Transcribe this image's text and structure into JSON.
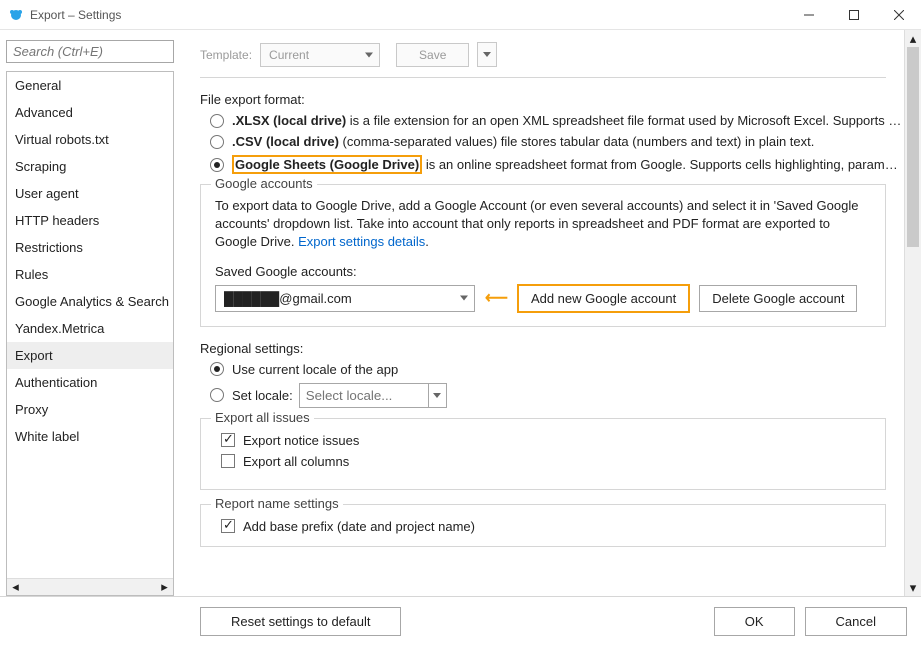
{
  "window": {
    "title": "Export – Settings"
  },
  "search": {
    "placeholder": "Search (Ctrl+E)"
  },
  "sidebar": {
    "items": [
      {
        "label": "General"
      },
      {
        "label": "Advanced"
      },
      {
        "label": "Virtual robots.txt"
      },
      {
        "label": "Scraping"
      },
      {
        "label": "User agent"
      },
      {
        "label": "HTTP headers"
      },
      {
        "label": "Restrictions"
      },
      {
        "label": "Rules"
      },
      {
        "label": "Google Analytics & Search Co"
      },
      {
        "label": "Yandex.Metrica"
      },
      {
        "label": "Export"
      },
      {
        "label": "Authentication"
      },
      {
        "label": "Proxy"
      },
      {
        "label": "White label"
      }
    ],
    "selected_index": 10
  },
  "template": {
    "label": "Template:",
    "value": "Current",
    "save": "Save"
  },
  "fef": {
    "label": "File export format:",
    "options": [
      {
        "bold": ".XLSX (local drive)",
        "rest": " is a file extension for an open XML spreadsheet file format used by Microsoft Excel. Supports c…"
      },
      {
        "bold": ".CSV (local drive)",
        "rest": " (comma-separated values) file stores tabular data (numbers and text) in plain text."
      },
      {
        "bold": "Google Sheets (Google Drive)",
        "rest": " is an online spreadsheet format from Google. Supports cells highlighting, paramet…"
      }
    ],
    "checked_index": 2
  },
  "ga": {
    "legend": "Google accounts",
    "text1": "To export data to Google Drive, add a Google Account (or even several accounts) and select it in 'Saved Google accounts' dropdown list. Take into account that only reports in spreadsheet and PDF format are exported to Google Drive. ",
    "link": "Export settings details",
    "saved_label": "Saved Google accounts:",
    "selected_account": "██████@gmail.com",
    "add_btn": "Add new Google account",
    "del_btn": "Delete Google account"
  },
  "regional": {
    "label": "Regional settings:",
    "opt_current": "Use current locale of the app",
    "opt_set": "Set locale:",
    "locale_placeholder": "Select locale...",
    "checked_index": 0
  },
  "export_all": {
    "legend": "Export all issues",
    "notice": {
      "label": "Export notice issues",
      "checked": true
    },
    "columns": {
      "label": "Export all columns",
      "checked": false
    }
  },
  "report_name": {
    "legend": "Report name settings",
    "prefix": {
      "label": "Add base prefix (date and project name)",
      "checked": true
    }
  },
  "footer": {
    "reset": "Reset settings to default",
    "ok": "OK",
    "cancel": "Cancel"
  }
}
